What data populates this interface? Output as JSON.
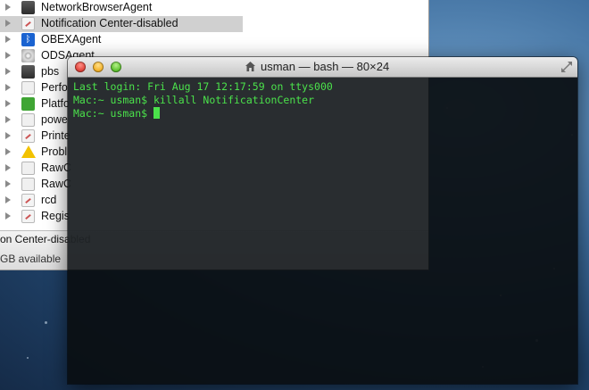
{
  "finder": {
    "items": [
      {
        "label": "NetworkBrowserAgent",
        "icon": "binary-icon",
        "selected": false
      },
      {
        "label": "Notification Center-disabled",
        "icon": "app-document-icon",
        "selected": true
      },
      {
        "label": "OBEXAgent",
        "icon": "bluetooth-icon",
        "selected": false
      },
      {
        "label": "ODSAgent",
        "icon": "disc-icon",
        "selected": false
      },
      {
        "label": "pbs",
        "icon": "binary-icon",
        "selected": false
      },
      {
        "label": "Perfo",
        "icon": "shield-icon",
        "selected": false
      },
      {
        "label": "Platfo",
        "icon": "leaf-icon",
        "selected": false
      },
      {
        "label": "powe",
        "icon": "shield-icon",
        "selected": false
      },
      {
        "label": "Printe",
        "icon": "app-document-icon",
        "selected": false
      },
      {
        "label": "Probl",
        "icon": "warning-icon",
        "selected": false
      },
      {
        "label": "RawC",
        "icon": "shield-icon",
        "selected": false
      },
      {
        "label": "RawC",
        "icon": "shield-icon",
        "selected": false
      },
      {
        "label": "rcd",
        "icon": "app-document-icon",
        "selected": false
      },
      {
        "label": "Regis",
        "icon": "app-document-icon",
        "selected": false
      }
    ],
    "status": {
      "selected_name": "on Center-disabled",
      "available": "GB available"
    }
  },
  "terminal": {
    "title": "usman — bash — 80×24",
    "lines": [
      "Last login: Fri Aug 17 12:17:59 on ttys000",
      "Mac:~ usman$ killall NotificationCenter",
      "Mac:~ usman$ "
    ]
  },
  "colors": {
    "terminal_text": "#4be24b",
    "terminal_bg": "#0a0e11",
    "selection": "#d0d0d0"
  }
}
